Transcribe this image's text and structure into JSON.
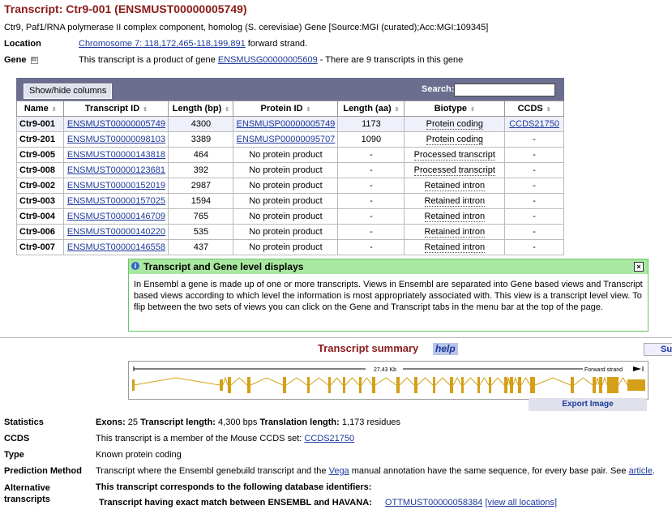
{
  "title": "Transcript: Ctr9-001 (ENSMUST00000005749)",
  "description": "Ctr9, Paf1/RNA polymerase II complex component, homolog (S. cerevisiae) Gene [Source:MGI (curated);Acc:MGI:109345]",
  "location": {
    "label": "Location",
    "link": "Chromosome 7: 118,172,465-118,199,891",
    "suffix": " forward strand."
  },
  "gene": {
    "label": "Gene",
    "toggle": "⊟",
    "prefix": "This transcript is a product of gene ",
    "link": "ENSMUSG00000005609",
    "suffix": " - There are 9 transcripts in this gene"
  },
  "table": {
    "show_hide": "Show/hide columns",
    "search_label": "Search:",
    "headers": [
      "Name",
      "Transcript ID",
      "Length (bp)",
      "Protein ID",
      "Length (aa)",
      "Biotype",
      "CCDS"
    ],
    "rows": [
      [
        "Ctr9-001",
        "ENSMUST00000005749",
        "4300",
        "ENSMUSP00000005749",
        "1173",
        "Protein coding",
        "CCDS21750"
      ],
      [
        "Ctr9-201",
        "ENSMUST00000098103",
        "3389",
        "ENSMUSP00000095707",
        "1090",
        "Protein coding",
        "-"
      ],
      [
        "Ctr9-005",
        "ENSMUST00000143818",
        "464",
        "No protein product",
        "-",
        "Processed transcript",
        "-"
      ],
      [
        "Ctr9-008",
        "ENSMUST00000123681",
        "392",
        "No protein product",
        "-",
        "Processed transcript",
        "-"
      ],
      [
        "Ctr9-002",
        "ENSMUST00000152019",
        "2987",
        "No protein product",
        "-",
        "Retained intron",
        "-"
      ],
      [
        "Ctr9-003",
        "ENSMUST00000157025",
        "1594",
        "No protein product",
        "-",
        "Retained intron",
        "-"
      ],
      [
        "Ctr9-004",
        "ENSMUST00000146709",
        "765",
        "No protein product",
        "-",
        "Retained intron",
        "-"
      ],
      [
        "Ctr9-006",
        "ENSMUST00000140220",
        "535",
        "No protein product",
        "-",
        "Retained intron",
        "-"
      ],
      [
        "Ctr9-007",
        "ENSMUST00000146558",
        "437",
        "No protein product",
        "-",
        "Retained intron",
        "-"
      ]
    ]
  },
  "note": {
    "title": "Transcript and Gene level displays",
    "body": "In Ensembl a gene is made up of one or more transcripts. Views in Ensembl are separated into Gene based views and Transcript based views according to which level the information is most appropriately associated with. This view is a transcript level view. To flip between the two sets of views you can click on the Gene and Transcript tabs in the menu bar at the top of the page."
  },
  "summary": {
    "title": "Transcript summary",
    "help": "help",
    "su": "Su",
    "kb_label": "27.43 Kb",
    "strand_label": "Forward strand",
    "export": "Export Image"
  },
  "stats": {
    "statistics_label": "Statistics",
    "exons_lbl": "Exons:",
    "exons": "25",
    "tlen_lbl": "Transcript length:",
    "tlen": "4,300 bps",
    "trlen_lbl": "Translation length:",
    "trlen": "1,173 residues",
    "ccds_label": "CCDS",
    "ccds_text": "This transcript is a member of the Mouse CCDS set: ",
    "ccds_link": "CCDS21750",
    "type_label": "Type",
    "type_text": "Known protein coding",
    "pred_label": "Prediction Method",
    "pred_text1": "Transcript where the Ensembl genebuild transcript and the ",
    "pred_vega": "Vega",
    "pred_text2": " manual annotation have the same sequence, for every base pair. See ",
    "pred_article": "article",
    "pred_end": ".",
    "alt_label1": "Alternative",
    "alt_label2": "transcripts",
    "alt_text": "This transcript corresponds to the following database identifiers:",
    "havana_text": "Transcript having exact match between ENSEMBL and HAVANA:",
    "havana_link": "OTTMUST00000058384",
    "view_all": "[view all locations]"
  },
  "colors": {
    "exon": "#d4a017",
    "title": "#8b1a1a",
    "link": "#1e3a9c"
  }
}
